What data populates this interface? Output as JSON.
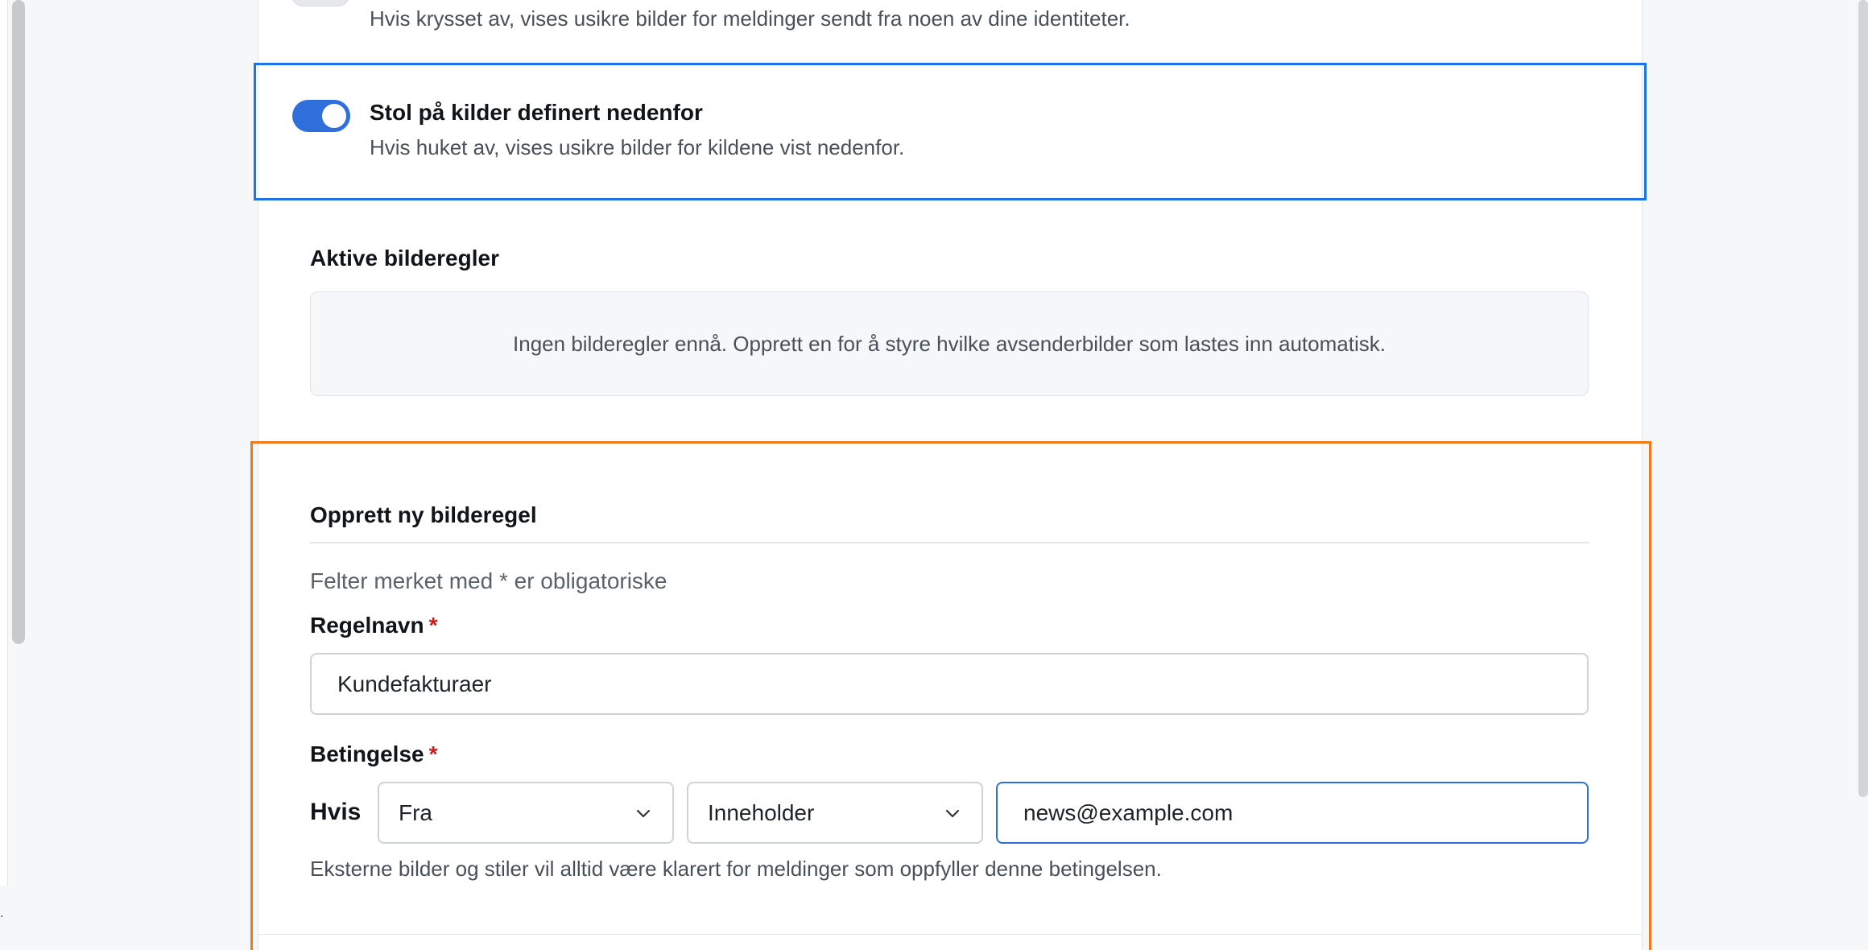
{
  "show_images": {
    "identities_toggle": {
      "description": "Hvis krysset av, vises usikre bilder for meldinger sendt fra noen av dine identiteter."
    },
    "trust_sources_toggle": {
      "title": "Stol på kilder definert nedenfor",
      "description": "Hvis huket av, vises usikre bilder for kildene vist nedenfor.",
      "checked": true
    }
  },
  "active_rules": {
    "heading": "Aktive bilderegler",
    "empty_message": "Ingen bilderegler ennå. Opprett en for å styre hvilke avsenderbilder som lastes inn automatisk."
  },
  "create_rule": {
    "heading": "Opprett ny bilderegel",
    "required_note": "Felter merket med * er obligatoriske",
    "name_label": "Regelnavn",
    "required_mark": "*",
    "name_value": "Kundefakturaer",
    "condition_label": "Betingelse",
    "if_label": "Hvis",
    "field_select": "Fra",
    "operator_select": "Inneholder",
    "condition_value": "news@example.com",
    "help_text": "Eksterne bilder og stiler vil alltid være klarert for meldinger som oppfyller denne betingelsen."
  },
  "colors": {
    "accent": "#2f6fdb",
    "focus_outline_blue": "#1a73e8",
    "focus_outline_orange": "#f07a1a",
    "required": "#d11a1a"
  },
  "left_marker": "."
}
